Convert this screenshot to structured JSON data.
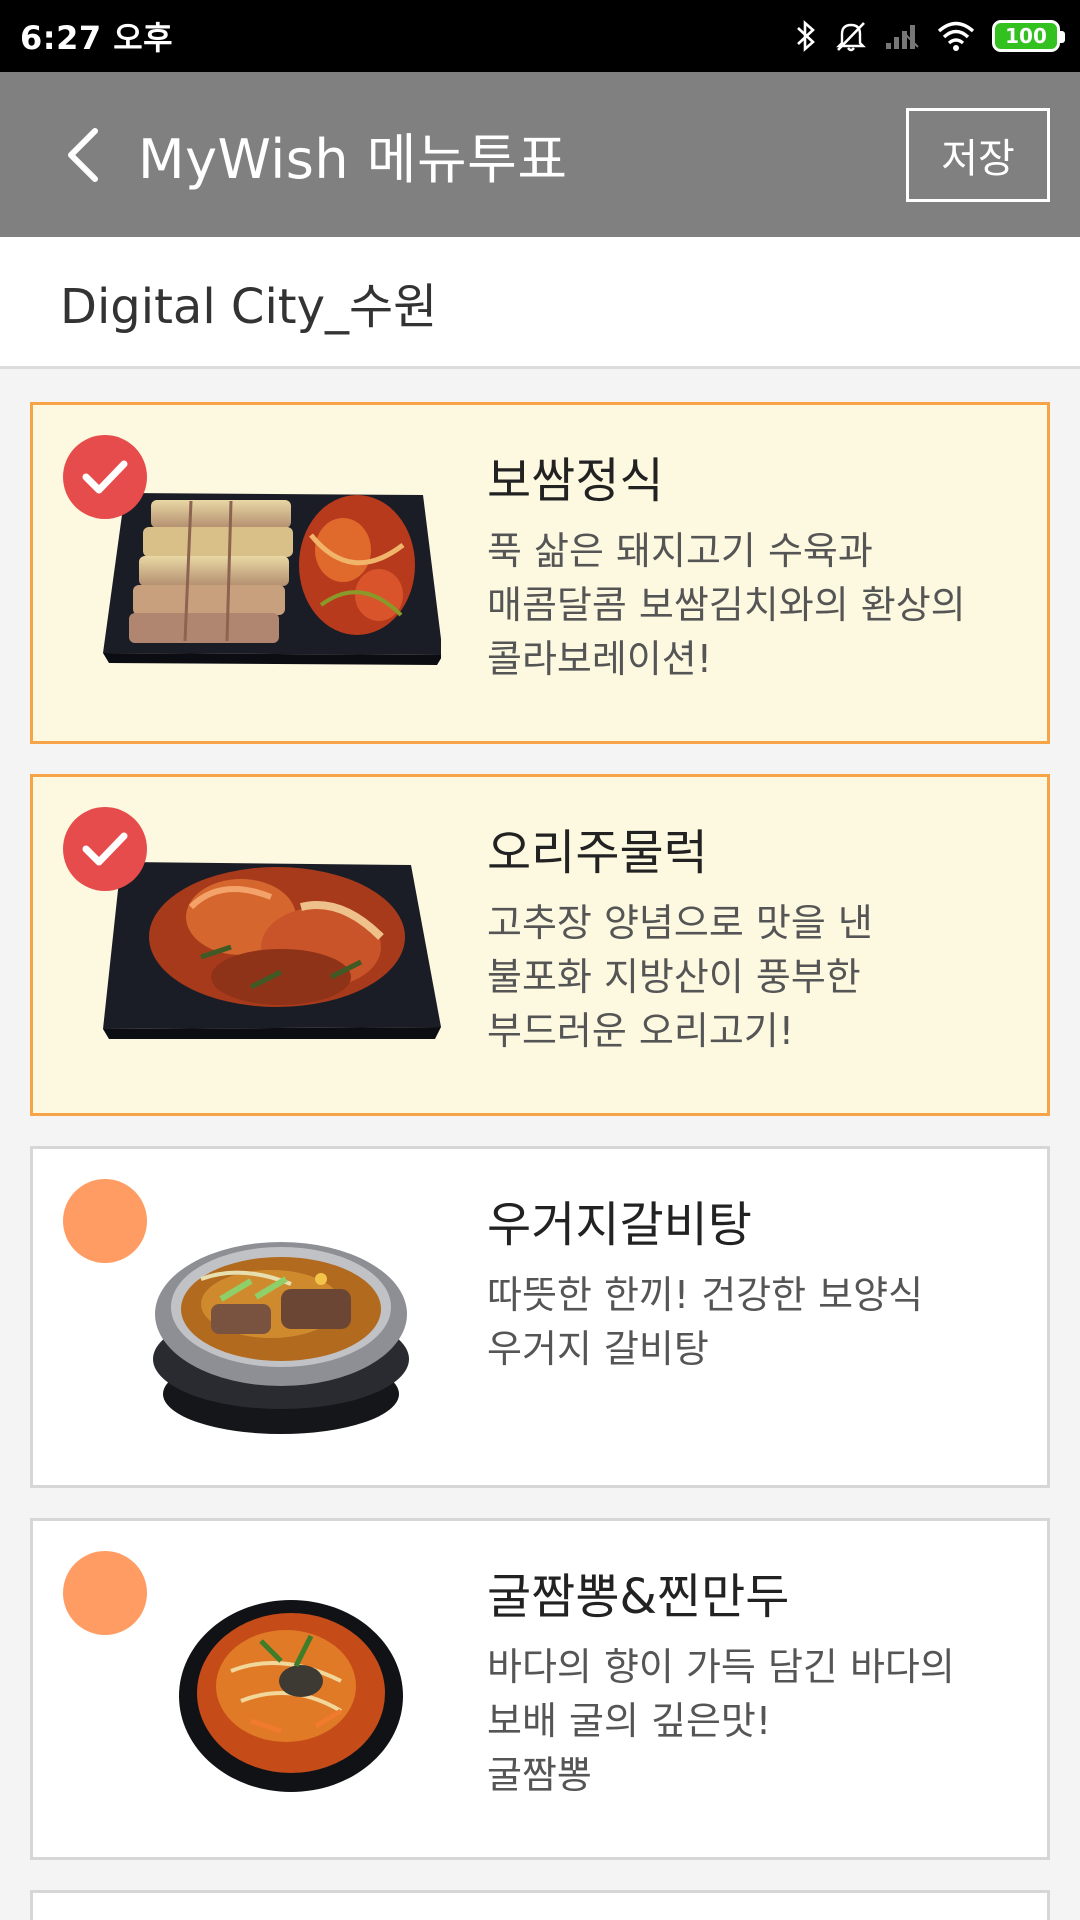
{
  "status_bar": {
    "time": "6:27 오후",
    "battery": "100",
    "icons": [
      "bluetooth-icon",
      "bell-off-icon",
      "signal-icon",
      "wifi-icon",
      "battery-icon"
    ]
  },
  "app_bar": {
    "title": "MyWish 메뉴투표",
    "save_label": "저장",
    "back_icon": "chevron-left-icon"
  },
  "location": {
    "name": "Digital City_수원"
  },
  "colors": {
    "app_bar": "#808080",
    "selected_border": "#f7a347",
    "selected_bg": "#fdf9e1",
    "check_selected": "#e74c4c",
    "check_unselected": "#ff9c63"
  },
  "menu_items": [
    {
      "name": "보쌈정식",
      "description": "푹 삶은 돼지고기 수육과\n매콤달콤 보쌈김치와의 환상의\n콜라보레이션!",
      "selected": true,
      "image": "bossam-plate-image"
    },
    {
      "name": "오리주물럭",
      "description": "고추장 양념으로 맛을 낸\n불포화 지방산이 풍부한\n부드러운 오리고기!",
      "selected": true,
      "image": "duck-jumulleok-plate-image"
    },
    {
      "name": "우거지갈비탕",
      "description": "따뜻한 한끼! 건강한 보양식\n우거지 갈비탕",
      "selected": false,
      "image": "galbitang-bowl-image"
    },
    {
      "name": "굴짬뽕&찐만두",
      "description": "바다의 향이 가득 담긴 바다의\n보배 굴의 깊은맛!\n굴짬뽕",
      "selected": false,
      "image": "jjamppong-bowl-image"
    }
  ]
}
